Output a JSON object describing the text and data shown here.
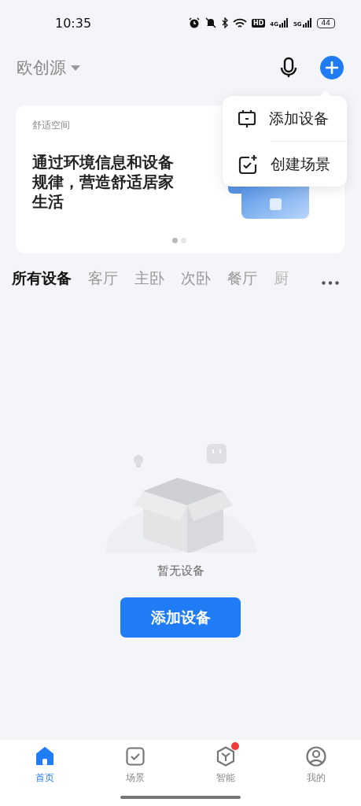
{
  "status_bar": {
    "time": "10:35",
    "hd": "HD",
    "networks": [
      {
        "label": "4G"
      },
      {
        "label": "5G"
      }
    ],
    "battery": "44"
  },
  "header": {
    "home_name": "欧创源"
  },
  "menu": {
    "items": [
      {
        "kind": "device",
        "label": "添加设备"
      },
      {
        "kind": "scene",
        "label": "创建场景"
      }
    ]
  },
  "banner": {
    "caption": "舒适空间",
    "headline": "通过环境信息和设备规律，营造舒适居家生活",
    "dots": [
      {
        "selected": true
      },
      {
        "selected": false
      }
    ]
  },
  "rooms": [
    {
      "label": "所有设备",
      "selected": true
    },
    {
      "label": "客厅",
      "selected": false
    },
    {
      "label": "主卧",
      "selected": false
    },
    {
      "label": "次卧",
      "selected": false
    },
    {
      "label": "餐厅",
      "selected": false
    },
    {
      "label": "厨",
      "selected": false
    }
  ],
  "empty": {
    "message": "暂无设备",
    "button": "添加设备"
  },
  "tab_bar": [
    {
      "kind": "home",
      "label": "首页",
      "selected": true,
      "badge": false
    },
    {
      "kind": "scene",
      "label": "场景",
      "selected": false,
      "badge": false
    },
    {
      "kind": "smart",
      "label": "智能",
      "selected": false,
      "badge": true
    },
    {
      "kind": "profile",
      "label": "我的",
      "selected": false,
      "badge": false
    }
  ]
}
